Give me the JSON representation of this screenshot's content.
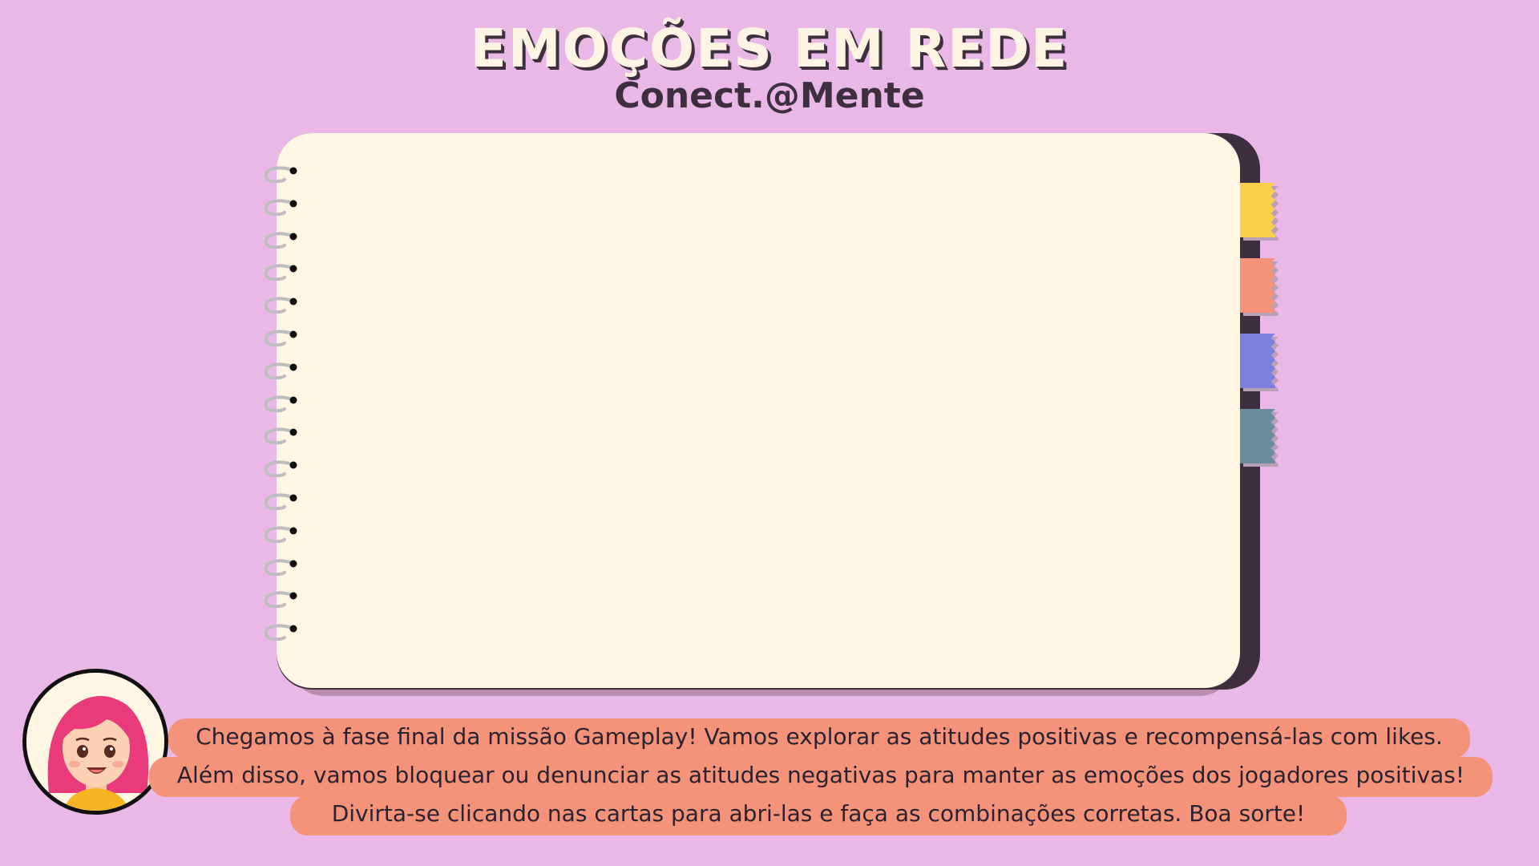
{
  "header": {
    "title": "EMOÇÕES EM REDE",
    "subtitle": "Conect.@Mente"
  },
  "notebook": {
    "tab_colors": [
      "#f9cf4b",
      "#f5937a",
      "#7b7fdd",
      "#6a8c9b"
    ],
    "ring_count": 15
  },
  "dialogue": {
    "lines": [
      "Chegamos à fase final da missão Gameplay! Vamos explorar as atitudes positivas e recompensá-las com likes.",
      "Além disso, vamos bloquear ou denunciar as atitudes negativas para manter as emoções dos jogadores positivas!",
      "Divirta-se clicando nas cartas para abri-las e faça as combinações corretas. Boa sorte!"
    ]
  },
  "colors": {
    "background": "#e9b8e6",
    "page": "#fff6e4",
    "cover": "#3d2f3d",
    "speech_bubble": "#f5937a"
  },
  "icons": {
    "guide_avatar": "girl-pink-hair-avatar"
  }
}
